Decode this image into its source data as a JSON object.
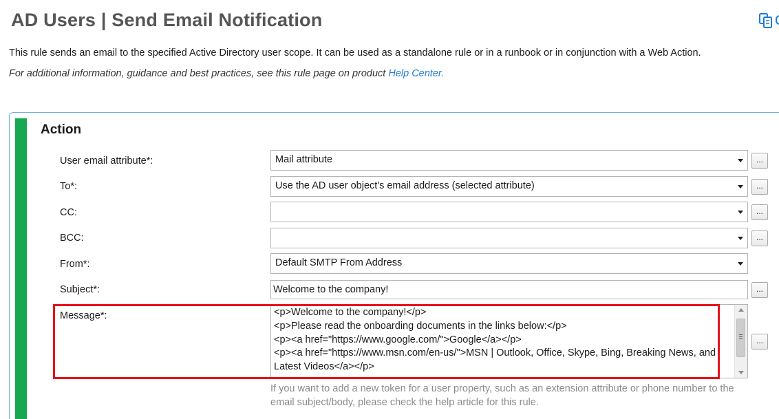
{
  "page": {
    "title": "AD Users | Send Email Notification",
    "description": "This rule sends an email to the specified Active Directory user scope. It can be used as a standalone rule or in a runbook or in conjunction with a Web Action.",
    "info_prefix": "For additional information, guidance and best practices, see this rule page on product ",
    "info_link": "Help Center.",
    "copy_icon": "copy-icon"
  },
  "action": {
    "section_title": "Action",
    "fields": {
      "user_email_attribute": {
        "label": "User email attribute*:",
        "value": "Mail attribute"
      },
      "to": {
        "label": "To*:",
        "value": "Use the AD user object's email address (selected attribute)"
      },
      "cc": {
        "label": "CC:",
        "value": ""
      },
      "bcc": {
        "label": "BCC:",
        "value": ""
      },
      "from": {
        "label": "From*:",
        "value": "Default SMTP From Address"
      },
      "subject": {
        "label": "Subject*:",
        "value": "Welcome to the company!"
      },
      "message": {
        "label": "Message*:",
        "value": "<p>Welcome to the company!</p>\n<p>Please read the onboarding documents in the links below:</p>\n<p><a href=\"https://www.google.com/\">Google</a></p>\n<p><a href=\"https://www.msn.com/en-us/\">MSN | Outlook, Office, Skype, Bing, Breaking News, and Latest Videos</a></p>"
      }
    },
    "browse_label": "...",
    "help_text": "If you want to add a new token for a user property, such as an extension attribute or phone number to the email subject/body, please check the help article for this rule."
  },
  "colors": {
    "accent_green": "#17a851",
    "link_blue": "#1f7bd6",
    "highlight_red": "#e8121b",
    "panel_border": "#6fb3e0"
  }
}
